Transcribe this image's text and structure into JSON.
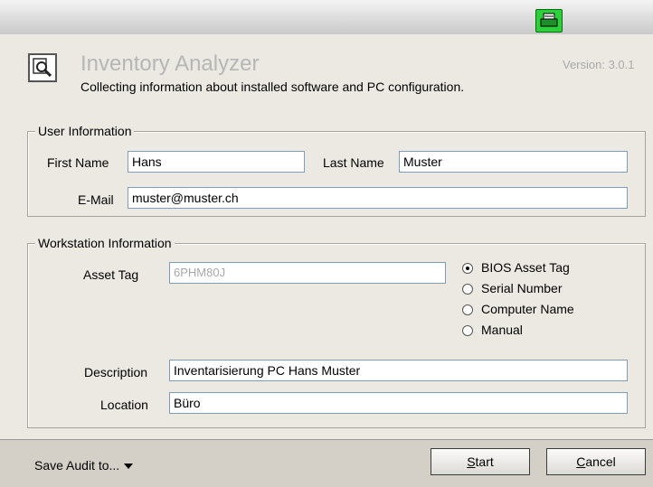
{
  "header": {
    "title": "Inventory Analyzer",
    "subtitle": "Collecting information about installed software and PC configuration.",
    "version": "Version: 3.0.1"
  },
  "user_info": {
    "legend": "User Information",
    "first_name_label": "First Name",
    "first_name_value": "Hans",
    "last_name_label": "Last Name",
    "last_name_value": "Muster",
    "email_label": "E-Mail",
    "email_value": "muster@muster.ch"
  },
  "workstation_info": {
    "legend": "Workstation Information",
    "asset_tag_label": "Asset Tag",
    "asset_tag_value": "6PHM80J",
    "radio_options": [
      "BIOS Asset Tag",
      "Serial Number",
      "Computer Name",
      "Manual"
    ],
    "radio_selected": "BIOS Asset Tag",
    "description_label": "Description",
    "description_value": "Inventarisierung PC Hans Muster",
    "location_label": "Location",
    "location_value": "Büro"
  },
  "footer": {
    "save_audit_label": "Save Audit to...",
    "start_label_mnemonic": "S",
    "start_label_rest": "tart",
    "cancel_label_mnemonic": "C",
    "cancel_label_rest": "ancel"
  },
  "icons": {
    "titlebar_icon": "printer-icon",
    "app_icon": "magnifier-icon"
  }
}
